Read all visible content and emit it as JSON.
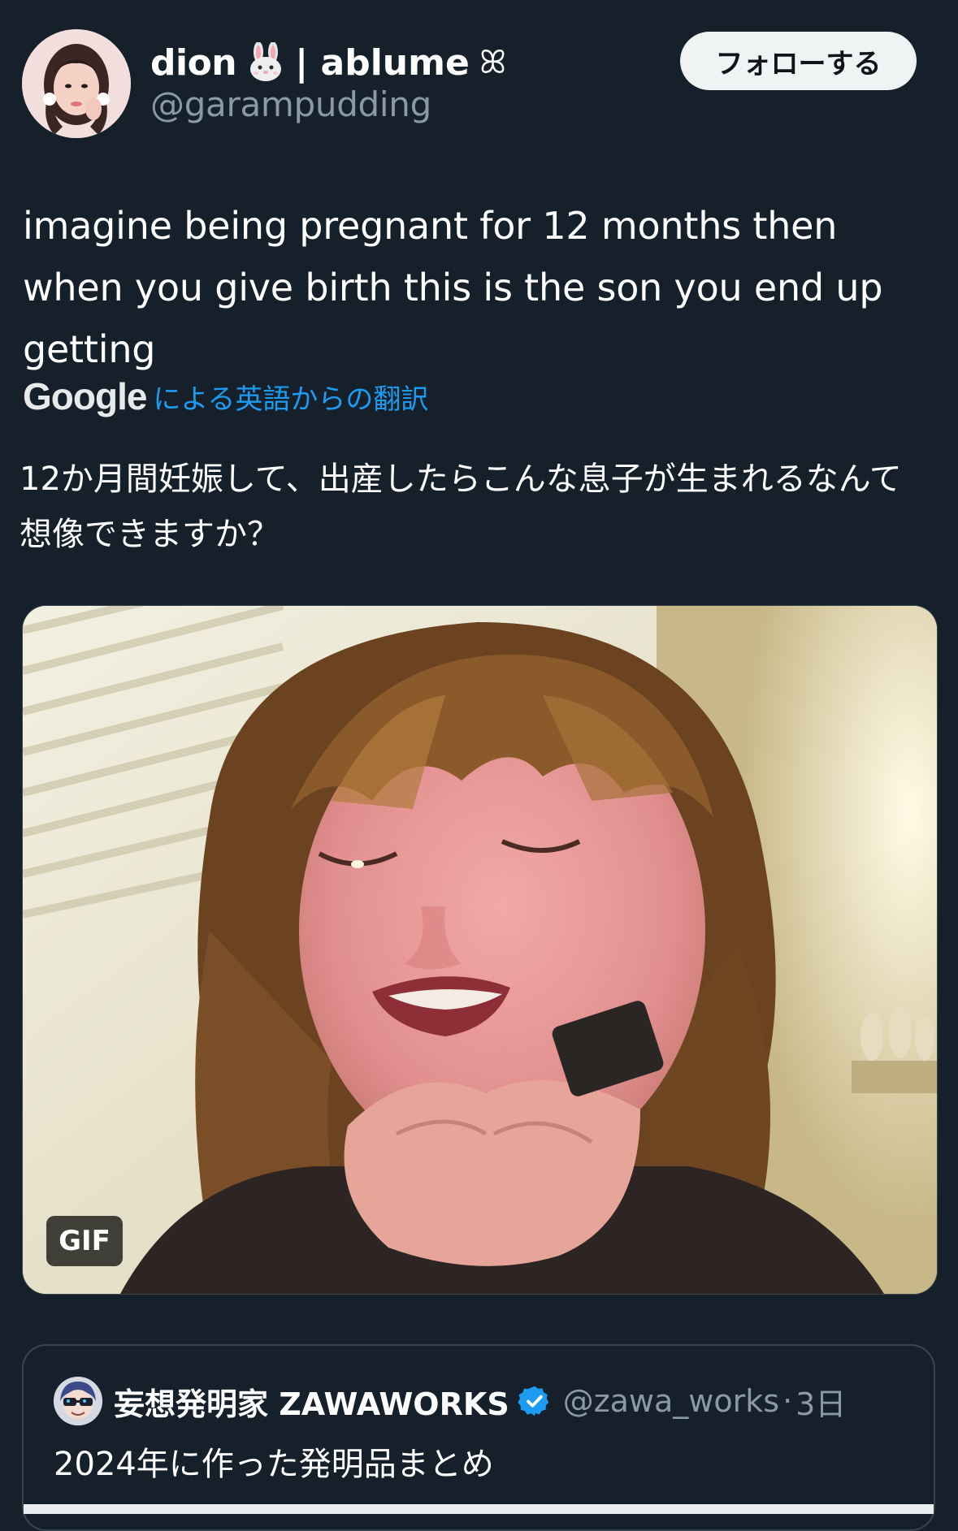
{
  "author": {
    "display_name": "dion",
    "name_suffix": "| ablume",
    "flower_glyph": "ꕤ",
    "handle": "@garampudding",
    "avatar_icon": "profile-photo"
  },
  "follow_button": {
    "label": "フォローする"
  },
  "tweet": {
    "text": "imagine being pregnant for 12 months then when you give birth this is the son you end up getting"
  },
  "translation": {
    "provider_logo": "Google",
    "label": "による英語からの翻訳",
    "text": "12か月間妊娠して、出産したらこんな息子が生まれるなんて想像できますか？"
  },
  "media": {
    "badge": "GIF"
  },
  "quote_tweet": {
    "display_name": "妄想発明家 ZAWAWORKS",
    "handle": "@zawa_works",
    "separator": "·",
    "time": "3日",
    "text": "2024年に作った発明品まとめ",
    "verified": true
  },
  "colors": {
    "background": "#15202b",
    "secondary_text": "#8b98a5",
    "link": "#1d9bf0",
    "verified": "#1d9bf0",
    "border": "#38444d"
  }
}
